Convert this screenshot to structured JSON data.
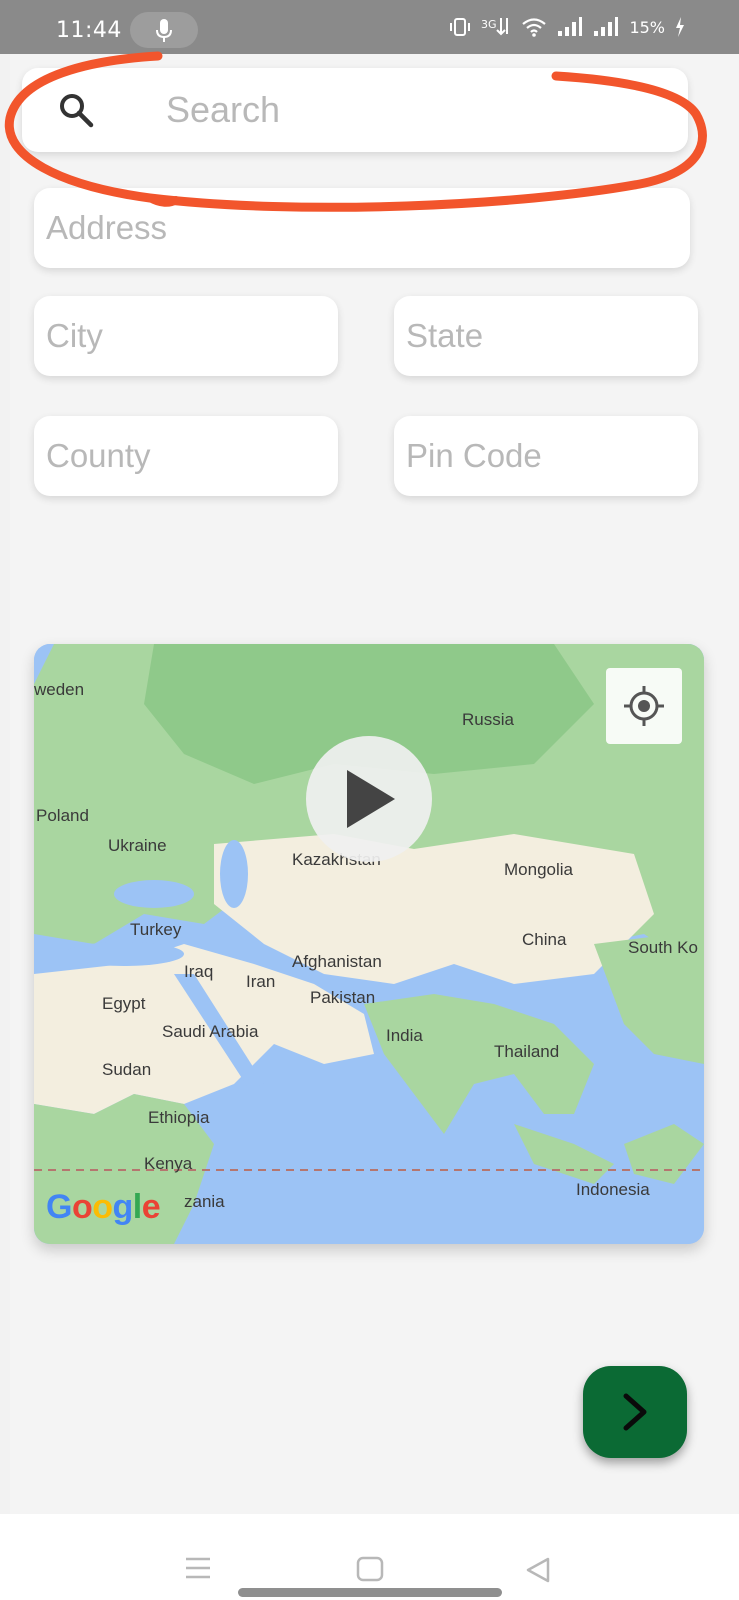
{
  "status_bar": {
    "time": "11:44",
    "battery": "15%",
    "icons": [
      "microphone-icon",
      "vibrate-icon",
      "data-icon",
      "wifi-icon",
      "signal-icon",
      "signal-icon-2",
      "charging-icon"
    ]
  },
  "search": {
    "placeholder": "Search",
    "icon": "search-icon"
  },
  "form": {
    "address_placeholder": "Address",
    "city_placeholder": "City",
    "state_placeholder": "State",
    "county_placeholder": "County",
    "pin_placeholder": "Pin Code"
  },
  "map": {
    "labels": {
      "sweden": "weden",
      "russia": "Russia",
      "poland": "Poland",
      "ukraine": "Ukraine",
      "kazakhstan": "Kazakhstan",
      "mongolia": "Mongolia",
      "turkey": "Turkey",
      "china": "China",
      "south_korea": "South Ko",
      "iraq": "Iraq",
      "iran": "Iran",
      "afghanistan": "Afghanistan",
      "pakistan": "Pakistan",
      "egypt": "Egypt",
      "saudi_arabia": "Saudi Arabia",
      "india": "India",
      "thailand": "Thailand",
      "sudan": "Sudan",
      "ethiopia": "Ethiopia",
      "kenya": "Kenya",
      "tanzania": "zania",
      "indonesia": "Indonesia"
    },
    "google_logo": "Google",
    "colors": {
      "water": "#9cc3f5",
      "land_green": "#a9d6a0",
      "land_dark_green": "#8fc98a",
      "land_sand": "#f3eedf"
    }
  },
  "next_button": {
    "icon": "chevron-right-icon",
    "color": "#0b6a34"
  },
  "annotation": {
    "color": "#f2552c"
  },
  "nav_bar": {
    "icons": [
      "menu-icon",
      "home-icon",
      "back-icon"
    ]
  }
}
